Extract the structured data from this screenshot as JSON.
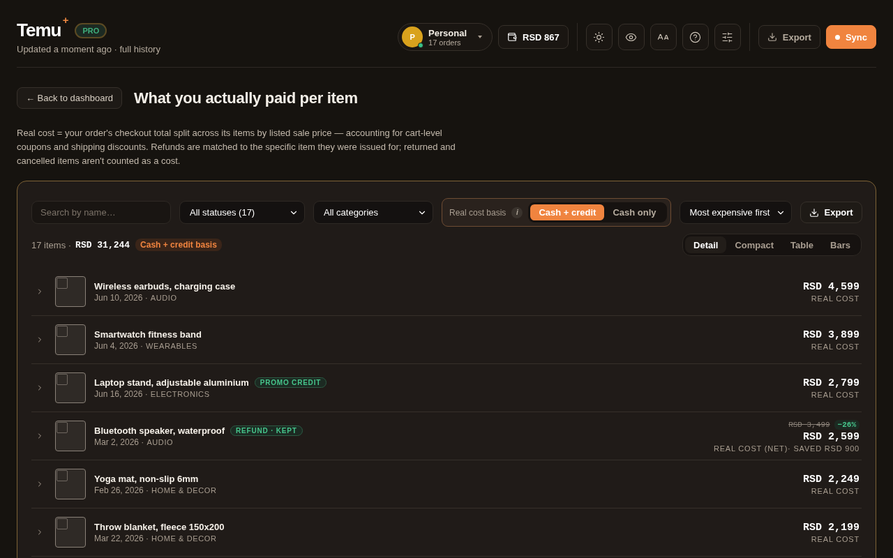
{
  "header": {
    "logo": "Temu",
    "logo_mark": "+",
    "plan_badge": "PRO",
    "subtitle": "Updated a moment ago · full history",
    "profile": {
      "initial": "P",
      "name": "Personal",
      "orders": "17 orders",
      "online": true
    },
    "wallet": "RSD 867",
    "tools": [
      {
        "kind": "theme"
      },
      {
        "kind": "privacy"
      },
      {
        "kind": "font"
      },
      {
        "kind": "help"
      },
      {
        "kind": "settings"
      }
    ],
    "export": "Export",
    "sync": "Sync"
  },
  "back": "← Back to dashboard",
  "title": "What you actually paid per item",
  "description": "Real cost = your order's checkout total split across its items by listed sale price — accounting for cart-level coupons and shipping discounts. Refunds are matched to the specific item they were issued for; returned and cancelled items aren't counted as a cost.",
  "filters": {
    "search": {
      "placeholder": "Search by name…"
    },
    "status": "All statuses (17)",
    "category": "All categories",
    "basis": {
      "label": "Real cost basis",
      "info": "i",
      "options": [
        {
          "label": "Cash + credit",
          "selected": true
        },
        {
          "label": "Cash only",
          "selected": false
        }
      ]
    },
    "sort": "Most expensive first",
    "export": "Export"
  },
  "summary": {
    "count": "17 items ·",
    "total": "RSD 31,244",
    "tag": "Cash + credit basis"
  },
  "views": [
    {
      "label": "Detail",
      "selected": true
    },
    {
      "label": "Compact",
      "selected": false
    },
    {
      "label": "Table",
      "selected": false
    },
    {
      "label": "Bars",
      "selected": false
    }
  ],
  "items": [
    {
      "name": "Wireless earbuds, charging case",
      "date": "Jun 10, 2026 ·",
      "category": "AUDIO",
      "price": "RSD 4,599",
      "caption": "REAL COST"
    },
    {
      "name": "Smartwatch fitness band",
      "date": "Jun 4, 2026 ·",
      "category": "WEARABLES",
      "price": "RSD 3,899",
      "caption": "REAL COST"
    },
    {
      "name": "Laptop stand, adjustable aluminium",
      "badge": "PROMO CREDIT",
      "date": "Jun 16, 2026 ·",
      "category": "ELECTRONICS",
      "price": "RSD 2,799",
      "caption": "REAL COST"
    },
    {
      "name": "Bluetooth speaker, waterproof",
      "badge": "REFUND · KEPT",
      "date": "Mar 2, 2026 ·",
      "category": "AUDIO",
      "original": "RSD 3,499",
      "discount": "−26%",
      "price": "RSD 2,599",
      "caption": "REAL COST (NET)· SAVED RSD 900"
    },
    {
      "name": "Yoga mat, non-slip 6mm",
      "date": "Feb 26, 2026 ·",
      "category": "HOME & DECOR",
      "price": "RSD 2,249",
      "caption": "REAL COST"
    },
    {
      "name": "Throw blanket, fleece 150x200",
      "date": "Mar 22, 2026 ·",
      "category": "HOME & DECOR",
      "price": "RSD 2,199",
      "caption": "REAL COST"
    }
  ]
}
